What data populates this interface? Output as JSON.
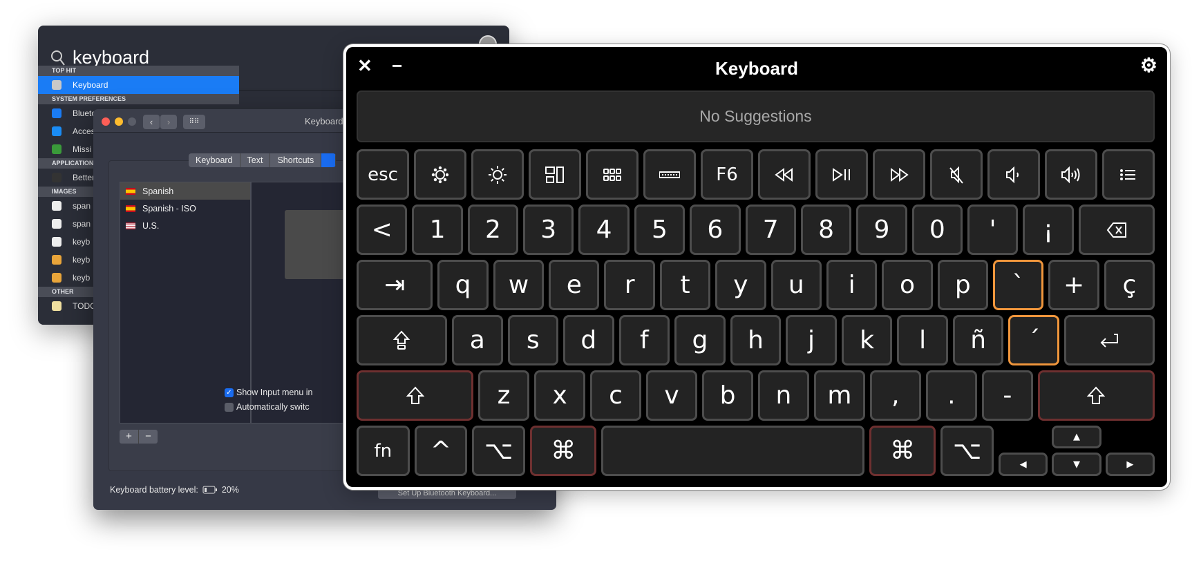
{
  "spotlight": {
    "query": "keyboard",
    "sections": [
      {
        "header": "TOP HIT",
        "items": [
          {
            "label": "Keyboard",
            "selected": true,
            "color": "#c8c8c8"
          }
        ]
      },
      {
        "header": "SYSTEM PREFERENCES",
        "items": [
          {
            "label": "Blueto",
            "color": "#1a7cf5"
          },
          {
            "label": "Acces",
            "color": "#1a8cf5"
          },
          {
            "label": "Missi",
            "color": "#3a9a3a"
          }
        ]
      },
      {
        "header": "APPLICATIONS",
        "items": [
          {
            "label": "Better",
            "color": "#333"
          }
        ]
      },
      {
        "header": "IMAGES",
        "items": [
          {
            "label": "span",
            "color": "#eee"
          },
          {
            "label": "span",
            "color": "#eee"
          },
          {
            "label": "keyb",
            "color": "#eee"
          },
          {
            "label": "keyb",
            "color": "#e9a53a"
          },
          {
            "label": "keyb",
            "color": "#e9a53a"
          }
        ]
      },
      {
        "header": "OTHER",
        "items": [
          {
            "label": "TODO",
            "color": "#f0e0a0"
          }
        ]
      }
    ]
  },
  "prefs": {
    "title": "Keyboard",
    "tabs": [
      "Keyboard",
      "Text",
      "Shortcuts"
    ],
    "languages": [
      {
        "label": "Spanish",
        "selected": true
      },
      {
        "label": "Spanish - ISO"
      },
      {
        "label": "U.S."
      }
    ],
    "add": "+",
    "remove": "−",
    "show_input_menu": {
      "label": "Show Input menu in",
      "checked": true
    },
    "auto_switch": {
      "label": "Automatically switc",
      "checked": false
    },
    "battery_label": "Keyboard battery level:",
    "battery_value": "20%",
    "bluetooth_button": "Set Up Bluetooth Keyboard..."
  },
  "keyboard": {
    "title": "Keyboard",
    "close": "✕",
    "minimize": "−",
    "settings_icon": "gear-icon",
    "suggestions": "No Suggestions",
    "accent_colors": {
      "dead_key": "#f0963c",
      "modifier_active": "#6e3030"
    },
    "rows": [
      [
        {
          "label": "esc"
        },
        {
          "icon": "brightness-down-icon"
        },
        {
          "icon": "brightness-up-icon"
        },
        {
          "icon": "mission-control-icon"
        },
        {
          "icon": "launchpad-icon"
        },
        {
          "icon": "keyboard-backlight-icon"
        },
        {
          "label": "F6"
        },
        {
          "icon": "rewind-icon"
        },
        {
          "icon": "play-pause-icon"
        },
        {
          "icon": "fast-forward-icon"
        },
        {
          "icon": "mute-icon"
        },
        {
          "icon": "volume-down-icon"
        },
        {
          "icon": "volume-up-icon"
        },
        {
          "icon": "list-icon"
        }
      ],
      [
        {
          "label": "<"
        },
        {
          "label": "1"
        },
        {
          "label": "2"
        },
        {
          "label": "3"
        },
        {
          "label": "4"
        },
        {
          "label": "5"
        },
        {
          "label": "6"
        },
        {
          "label": "7"
        },
        {
          "label": "8"
        },
        {
          "label": "9"
        },
        {
          "label": "0"
        },
        {
          "label": "'"
        },
        {
          "label": "¡"
        },
        {
          "icon": "delete-icon"
        }
      ],
      [
        {
          "label": "⇥"
        },
        {
          "label": "q"
        },
        {
          "label": "w"
        },
        {
          "label": "e"
        },
        {
          "label": "r"
        },
        {
          "label": "t"
        },
        {
          "label": "y"
        },
        {
          "label": "u"
        },
        {
          "label": "i"
        },
        {
          "label": "o"
        },
        {
          "label": "p"
        },
        {
          "label": "`",
          "highlight": "dead_key"
        },
        {
          "label": "+"
        },
        {
          "label": "ç"
        }
      ],
      [
        {
          "icon": "caps-lock-icon"
        },
        {
          "label": "a"
        },
        {
          "label": "s"
        },
        {
          "label": "d"
        },
        {
          "label": "f"
        },
        {
          "label": "g"
        },
        {
          "label": "h"
        },
        {
          "label": "j"
        },
        {
          "label": "k"
        },
        {
          "label": "l"
        },
        {
          "label": "ñ"
        },
        {
          "label": "´",
          "highlight": "dead_key"
        },
        {
          "icon": "return-icon"
        }
      ],
      [
        {
          "icon": "shift-icon",
          "highlight": "modifier_active"
        },
        {
          "label": "z"
        },
        {
          "label": "x"
        },
        {
          "label": "c"
        },
        {
          "label": "v"
        },
        {
          "label": "b"
        },
        {
          "label": "n"
        },
        {
          "label": "m"
        },
        {
          "label": ","
        },
        {
          "label": "."
        },
        {
          "label": "-"
        },
        {
          "icon": "shift-icon",
          "highlight": "modifier_active"
        }
      ],
      [
        {
          "label": "fn"
        },
        {
          "label": "^"
        },
        {
          "label": "⌥"
        },
        {
          "label": "⌘",
          "highlight": "modifier_active"
        },
        {
          "label": ""
        },
        {
          "label": "⌘",
          "highlight": "modifier_active"
        },
        {
          "label": "⌥"
        }
      ]
    ],
    "arrows": {
      "up": "▲",
      "left": "◀",
      "down": "▼",
      "right": "▶"
    }
  }
}
